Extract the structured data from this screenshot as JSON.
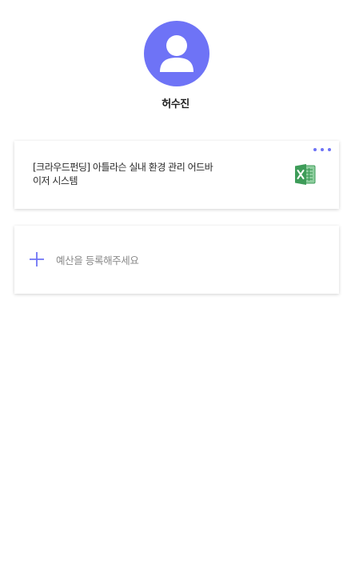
{
  "profile": {
    "name": "허수진",
    "avatar_icon": "user-icon",
    "avatar_color": "#6e73f6"
  },
  "budget_card": {
    "title": "[크라우드펀딩] 아틀라슨 실내 환경 관리 어드바이저 시스템",
    "file_icon": "excel-icon",
    "menu_icon": "more-horizontal-icon"
  },
  "add_card": {
    "label": "예산을 등록해주세요",
    "icon": "plus-icon",
    "accent_color": "#6e73f6"
  }
}
